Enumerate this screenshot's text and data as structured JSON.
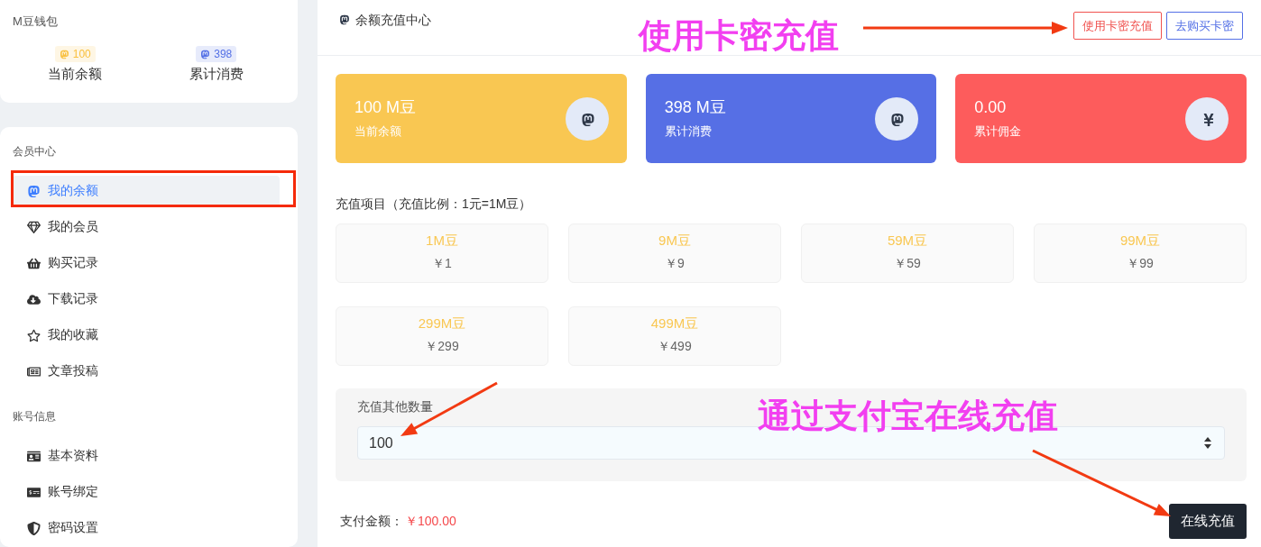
{
  "wallet": {
    "title": "M豆钱包",
    "stats": [
      {
        "value": "100",
        "label": "当前余额",
        "color": "#f9c03f"
      },
      {
        "value": "398",
        "label": "累计消费",
        "color": "#5470e6"
      }
    ]
  },
  "menu": [
    {
      "title": "会员中心",
      "items": [
        {
          "label": "我的余额",
          "selected": true
        },
        {
          "label": "我的会员",
          "selected": false
        },
        {
          "label": "购买记录",
          "selected": false
        },
        {
          "label": "下载记录",
          "selected": false
        },
        {
          "label": "我的收藏",
          "selected": false
        },
        {
          "label": "文章投稿",
          "selected": false
        }
      ]
    },
    {
      "title": "账号信息",
      "items": [
        {
          "label": "基本资料",
          "selected": false
        },
        {
          "label": "账号绑定",
          "selected": false
        },
        {
          "label": "密码设置",
          "selected": false
        }
      ]
    }
  ],
  "panel": {
    "title": "余额充值中心",
    "buttons": [
      {
        "label": "使用卡密充值",
        "color": "#f0524f"
      },
      {
        "label": "去购买卡密",
        "color": "#5470e6"
      }
    ],
    "cards": [
      {
        "value": "100 M豆",
        "label": "当前余额",
        "color": "#f9c752"
      },
      {
        "value": "398 M豆",
        "label": "累计消费",
        "color": "#566fe5"
      },
      {
        "value": "0.00",
        "label": "累计佣金",
        "color": "#fd5c5c"
      }
    ],
    "packages_title": "充值项目（充值比例：1元=1M豆）",
    "packages": [
      {
        "amount": "1M豆",
        "price": "￥1"
      },
      {
        "amount": "9M豆",
        "price": "￥9"
      },
      {
        "amount": "59M豆",
        "price": "￥59"
      },
      {
        "amount": "99M豆",
        "price": "￥99"
      },
      {
        "amount": "299M豆",
        "price": "￥299"
      },
      {
        "amount": "499M豆",
        "price": "￥499"
      }
    ],
    "custom": {
      "label": "充值其他数量",
      "value": "100"
    },
    "payment": {
      "label": "支付金额：",
      "amount": "￥100.00",
      "button": "在线充值"
    }
  },
  "annotations": [
    "使用卡密充值",
    "通过支付宝在线充值"
  ]
}
